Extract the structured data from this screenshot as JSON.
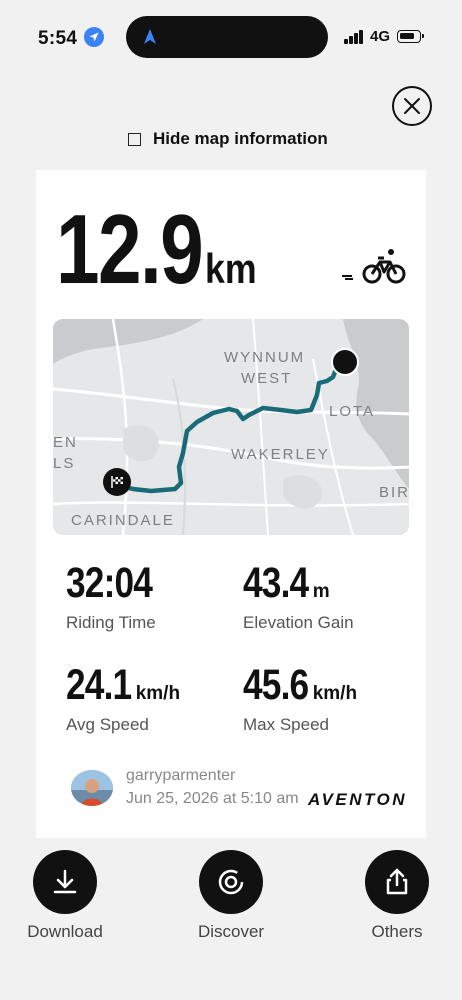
{
  "status_bar": {
    "time": "5:54",
    "network": "4G",
    "battery_level": 0.8
  },
  "header": {
    "hide_map_label": "Hide map information",
    "hide_map_checked": false
  },
  "ride": {
    "distance_value": "12.9",
    "distance_unit": "km",
    "activity_icon": "bicycle-icon",
    "map_labels": [
      "WYNNUM",
      "WEST",
      "LOTA",
      "WAKERLEY",
      "EN",
      "LS",
      "BIR",
      "CARINDALE"
    ],
    "stats": [
      {
        "value": "32:04",
        "unit": "",
        "label": "Riding Time"
      },
      {
        "value": "43.4",
        "unit": "m",
        "label": "Elevation Gain"
      },
      {
        "value": "24.1",
        "unit": "km/h",
        "label": "Avg Speed"
      },
      {
        "value": "45.6",
        "unit": "km/h",
        "label": "Max Speed"
      }
    ],
    "user_name": "garryparmenter",
    "date": "Jun 25, 2026 at 5:10 am",
    "brand": "AVENTON",
    "route_color": "#1a6b78"
  },
  "actions": [
    {
      "label": "Download",
      "icon": "download-icon"
    },
    {
      "label": "Discover",
      "icon": "discover-icon"
    },
    {
      "label": "Others",
      "icon": "share-icon"
    }
  ]
}
